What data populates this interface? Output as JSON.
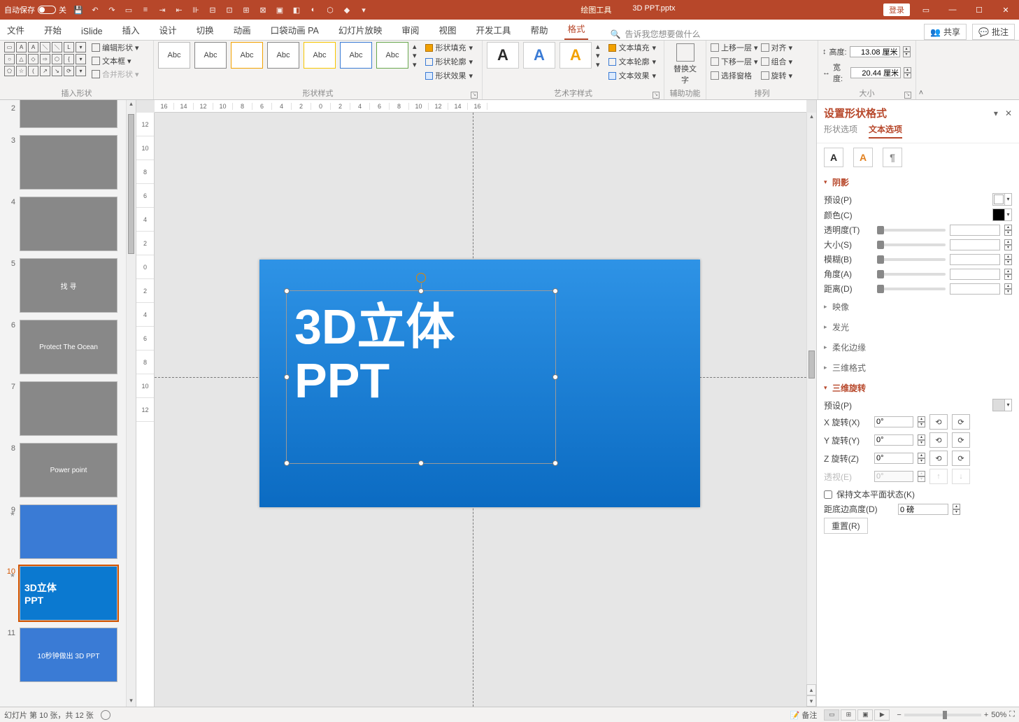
{
  "titlebar": {
    "autosave_label": "自动保存",
    "autosave_state": "关",
    "tool_context": "绘图工具",
    "doc_title": "3D PPT.pptx",
    "signin": "登录"
  },
  "tabs": {
    "items": [
      "文件",
      "开始",
      "iSlide",
      "插入",
      "设计",
      "切换",
      "动画",
      "口袋动画 PA",
      "幻灯片放映",
      "审阅",
      "视图",
      "开发工具",
      "帮助",
      "格式"
    ],
    "active_index": 13,
    "tell_placeholder": "告诉我您想要做什么",
    "share": "共享",
    "comments": "批注"
  },
  "ribbon": {
    "insert_shapes": {
      "label": "插入形状",
      "edit_shape": "编辑形状",
      "text_box": "文本框",
      "merge": "合并形状"
    },
    "shape_styles": {
      "label": "形状样式",
      "swatch": "Abc",
      "fill": "形状填充",
      "outline": "形状轮廓",
      "effects": "形状效果"
    },
    "wordart": {
      "label": "艺术字样式",
      "glyph": "A",
      "fill": "文本填充",
      "outline": "文本轮廓",
      "effects": "文本效果"
    },
    "accessibility": {
      "label": "辅助功能",
      "alt": "替换文字"
    },
    "arrange": {
      "label": "排列",
      "bring": "上移一层",
      "send": "下移一层",
      "selpane": "选择窗格",
      "align": "对齐",
      "group": "组合",
      "rotate": "旋转"
    },
    "size": {
      "label": "大小",
      "height_l": "高度:",
      "height_v": "13.08 厘米",
      "width_l": "宽度:",
      "width_v": "20.44 厘米"
    }
  },
  "slides": {
    "items": [
      {
        "n": "2",
        "caption": ""
      },
      {
        "n": "3",
        "caption": ""
      },
      {
        "n": "4",
        "caption": ""
      },
      {
        "n": "5",
        "caption": "找 寻"
      },
      {
        "n": "6",
        "caption": "Protect The Ocean"
      },
      {
        "n": "7",
        "caption": ""
      },
      {
        "n": "8",
        "caption": "Power point"
      },
      {
        "n": "9",
        "caption": "",
        "starred": true
      },
      {
        "n": "10",
        "caption": "3D立体\nPPT",
        "starred": true,
        "selected": true
      },
      {
        "n": "11",
        "caption": "10秒钟做出 3D PPT"
      }
    ]
  },
  "ruler": {
    "h": [
      "16",
      "14",
      "12",
      "10",
      "8",
      "6",
      "4",
      "2",
      "0",
      "2",
      "4",
      "6",
      "8",
      "10",
      "12",
      "14",
      "16"
    ],
    "v": [
      "12",
      "10",
      "8",
      "6",
      "4",
      "2",
      "0",
      "2",
      "4",
      "6",
      "8",
      "10",
      "12"
    ]
  },
  "slide_text": {
    "line1": "3D立体",
    "line2": "PPT"
  },
  "pane": {
    "title": "设置形状格式",
    "opt_tabs": [
      "形状选项",
      "文本选项"
    ],
    "opt_active": 1,
    "shadow": {
      "head": "阴影",
      "preset": "预设(P)",
      "color": "颜色(C)",
      "trans": "透明度(T)",
      "size": "大小(S)",
      "blur": "模糊(B)",
      "angle": "角度(A)",
      "dist": "距离(D)"
    },
    "reflection": "映像",
    "glow": "发光",
    "soft": "柔化边缘",
    "fmt3d": "三维格式",
    "rot3d": {
      "head": "三维旋转",
      "preset": "预设(P)",
      "xr": "X 旋转(X)",
      "yr": "Y 旋转(Y)",
      "zr": "Z 旋转(Z)",
      "pv": "透视(E)",
      "xv": "0°",
      "yv": "0°",
      "zv": "0°",
      "pvv": "0°",
      "keepflat": "保持文本平面状态(K)",
      "distg": "距底边高度(D)",
      "distv": "0 磅",
      "reset": "重置(R)"
    }
  },
  "status": {
    "slide_of": "幻灯片 第 10 张，共 12 张",
    "notes": "备注",
    "zoom": "50%"
  }
}
